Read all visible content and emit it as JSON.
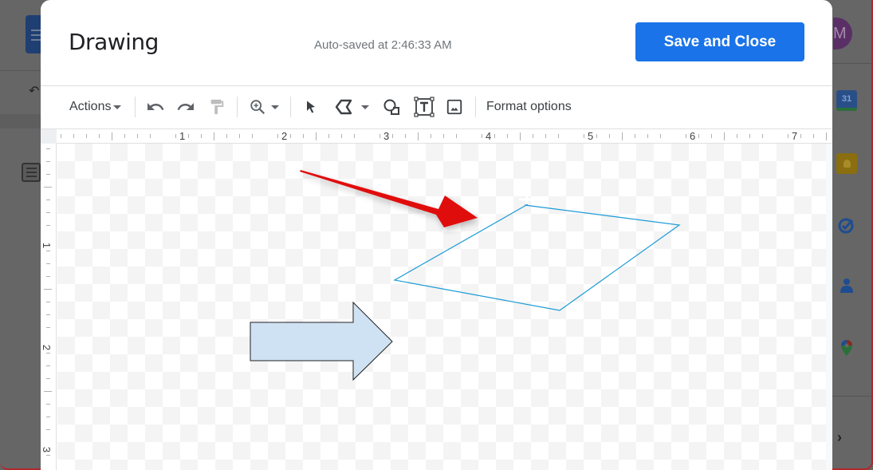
{
  "dialog": {
    "title": "Drawing",
    "autosave_text": "Auto-saved at 2:46:33 AM",
    "save_button_label": "Save and Close"
  },
  "toolbar": {
    "actions_label": "Actions",
    "format_options_label": "Format options",
    "icons": [
      "undo-icon",
      "redo-icon",
      "paint-format-icon",
      "zoom-icon",
      "select-icon",
      "line-tool-icon",
      "shape-icon",
      "text-box-icon",
      "image-icon"
    ]
  },
  "rulers": {
    "horizontal_labels": [
      "1",
      "2",
      "3",
      "4",
      "5",
      "6",
      "7"
    ],
    "vertical_labels": [
      "1",
      "2",
      "3"
    ]
  },
  "canvas": {
    "shapes": [
      {
        "type": "red-arrow",
        "color": "#e01010"
      },
      {
        "type": "polyline-quadrilateral",
        "stroke": "#1a9bd7"
      },
      {
        "type": "block-arrow-right",
        "fill": "#cfe2f3",
        "stroke": "#222222"
      }
    ]
  },
  "backdrop": {
    "right_sidebar_icons": [
      "calendar-icon",
      "keep-icon",
      "tasks-icon",
      "contacts-icon",
      "maps-icon"
    ],
    "calendar_day": "31",
    "avatar_initial": "M"
  },
  "colors": {
    "accent": "#1a73e8",
    "overlay": "#666666"
  }
}
